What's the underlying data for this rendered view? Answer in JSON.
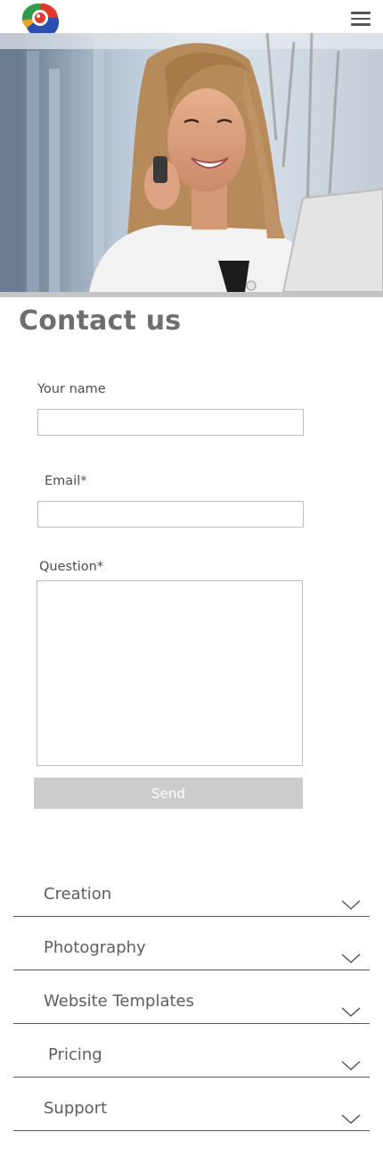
{
  "header": {
    "logo_icon": "camera-logo-icon",
    "menu_icon": "hamburger-menu-icon"
  },
  "hero": {
    "image": "woman-on-phone-photo"
  },
  "page": {
    "title": "Contact us"
  },
  "form": {
    "name_label": "Your name",
    "name_value": "",
    "email_label": "Email*",
    "email_value": "",
    "question_label": "Question*",
    "question_value": "",
    "send_label": "Send"
  },
  "accordion": [
    {
      "label": "Creation"
    },
    {
      "label": "Photography"
    },
    {
      "label": "Website Templates"
    },
    {
      "label": "Pricing"
    },
    {
      "label": "Support"
    }
  ],
  "colors": {
    "send_bg": "#cccccc",
    "title": "#6e6e6e",
    "divider": "#5a5a5a"
  }
}
